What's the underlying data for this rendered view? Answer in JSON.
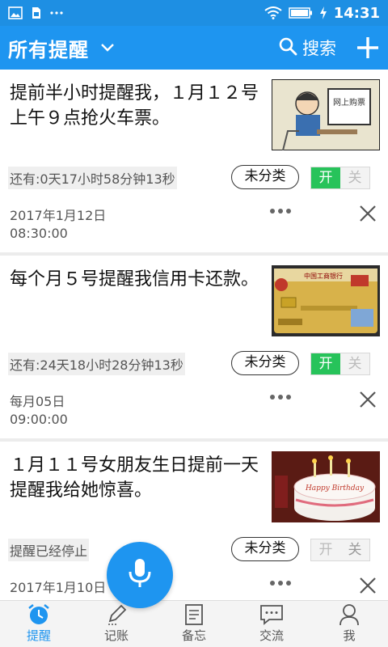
{
  "statusbar": {
    "time": "14:31"
  },
  "header": {
    "title": "所有提醒",
    "search_label": "搜索"
  },
  "reminders": [
    {
      "text": "提前半小时提醒我，１月１２号上午９点抢火车票。",
      "thumb_caption": "网上购票",
      "remain": "还有:0天17小时58分钟13秒",
      "category": "未分类",
      "toggle_on": "开",
      "toggle_off": "关",
      "enabled": true,
      "date_line1": "2017年1月12日",
      "date_line2": "08:30:00"
    },
    {
      "text": "每个月５号提醒我信用卡还款。",
      "thumb_caption": "中国工商银行",
      "remain": "还有:24天18小时28分钟13秒",
      "category": "未分类",
      "toggle_on": "开",
      "toggle_off": "关",
      "enabled": true,
      "date_line1": "每月05日",
      "date_line2": "09:00:00"
    },
    {
      "text": "１月１１号女朋友生日提前一天提醒我给她惊喜。",
      "thumb_caption": "Happy Birthday",
      "remain": "提醒已经停止",
      "category": "未分类",
      "toggle_on": "开",
      "toggle_off": "关",
      "enabled": false,
      "date_line1": "2017年1月10日",
      "date_line2": ""
    }
  ],
  "bottom_nav": [
    {
      "label": "提醒",
      "icon": "alarm-clock-icon",
      "active": true
    },
    {
      "label": "记账",
      "icon": "pencil-icon",
      "active": false
    },
    {
      "label": "备忘",
      "icon": "notepad-icon",
      "active": false
    },
    {
      "label": "交流",
      "icon": "chat-bubble-icon",
      "active": false
    },
    {
      "label": "我",
      "icon": "person-icon",
      "active": false
    }
  ],
  "colors": {
    "primary": "#1e95f0",
    "toggle_on": "#27c35a"
  }
}
